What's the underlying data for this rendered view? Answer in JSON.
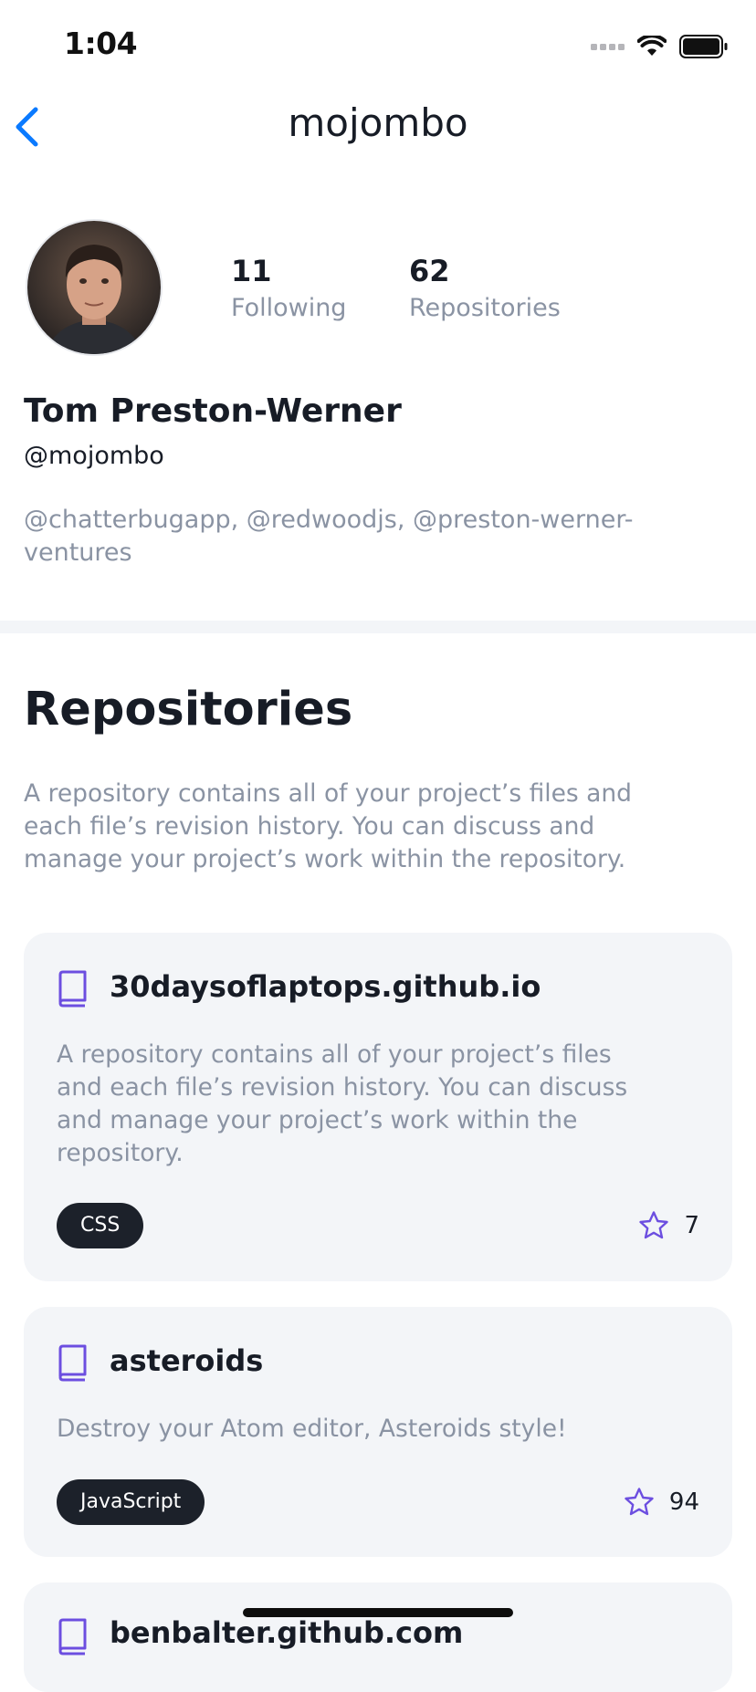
{
  "status_bar": {
    "time": "1:04"
  },
  "nav": {
    "title": "mojombo"
  },
  "profile": {
    "following_count": "11",
    "following_label": "Following",
    "repos_count": "62",
    "repos_label": "Repositories",
    "name": "Tom Preston-Werner",
    "handle": "@mojombo",
    "bio": "@chatterbugapp, @redwoodjs, @preston-werner-ventures"
  },
  "repositories_section": {
    "title": "Repositories",
    "description": "A repository contains all of your project’s files and each file’s revision history. You can discuss and manage your project’s work within the repository."
  },
  "repos": [
    {
      "name": "30daysoflaptops.github.io",
      "description": "A repository contains all of your project’s files and each file’s revision history. You can discuss and manage your project’s work within the repository.",
      "language": "CSS",
      "stars": "7"
    },
    {
      "name": "asteroids",
      "description": "Destroy your Atom editor, Asteroids style!",
      "language": "JavaScript",
      "stars": "94"
    },
    {
      "name": "benbalter.github.com"
    }
  ],
  "colors": {
    "accent": "#0a7aff",
    "icon_purple": "#6c4ee0",
    "chip_bg": "#1c212a",
    "muted": "#8a93a3"
  }
}
